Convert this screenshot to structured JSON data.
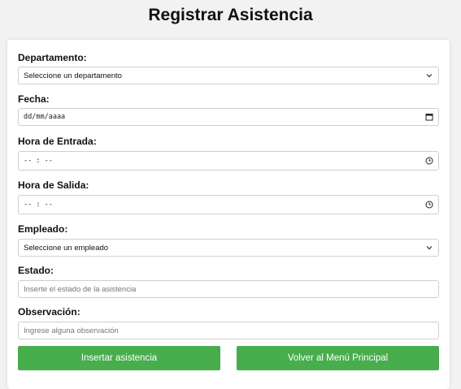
{
  "page": {
    "title": "Registrar Asistencia"
  },
  "form": {
    "departamento": {
      "label": "Departamento:",
      "value": "Seleccione un departamento"
    },
    "fecha": {
      "label": "Fecha:",
      "value": "dd/mm/aaaa"
    },
    "hora_entrada": {
      "label": "Hora de Entrada:",
      "value": "-- : --"
    },
    "hora_salida": {
      "label": "Hora de Salida:",
      "value": "-- : --"
    },
    "empleado": {
      "label": "Empleado:",
      "value": "Seleccione un empleado"
    },
    "estado": {
      "label": "Estado:",
      "placeholder": "Inserte el estado de la asistencia"
    },
    "observacion": {
      "label": "Observación:",
      "placeholder": "Ingrese alguna observación"
    }
  },
  "buttons": {
    "insert": "Insertar asistencia",
    "back": "Volver al Menú Principal"
  },
  "colors": {
    "accent": "#47ad4d",
    "background": "#f2f2f2"
  },
  "icons": {
    "select": "chevron-down-icon",
    "date": "calendar-icon",
    "time": "clock-icon"
  }
}
